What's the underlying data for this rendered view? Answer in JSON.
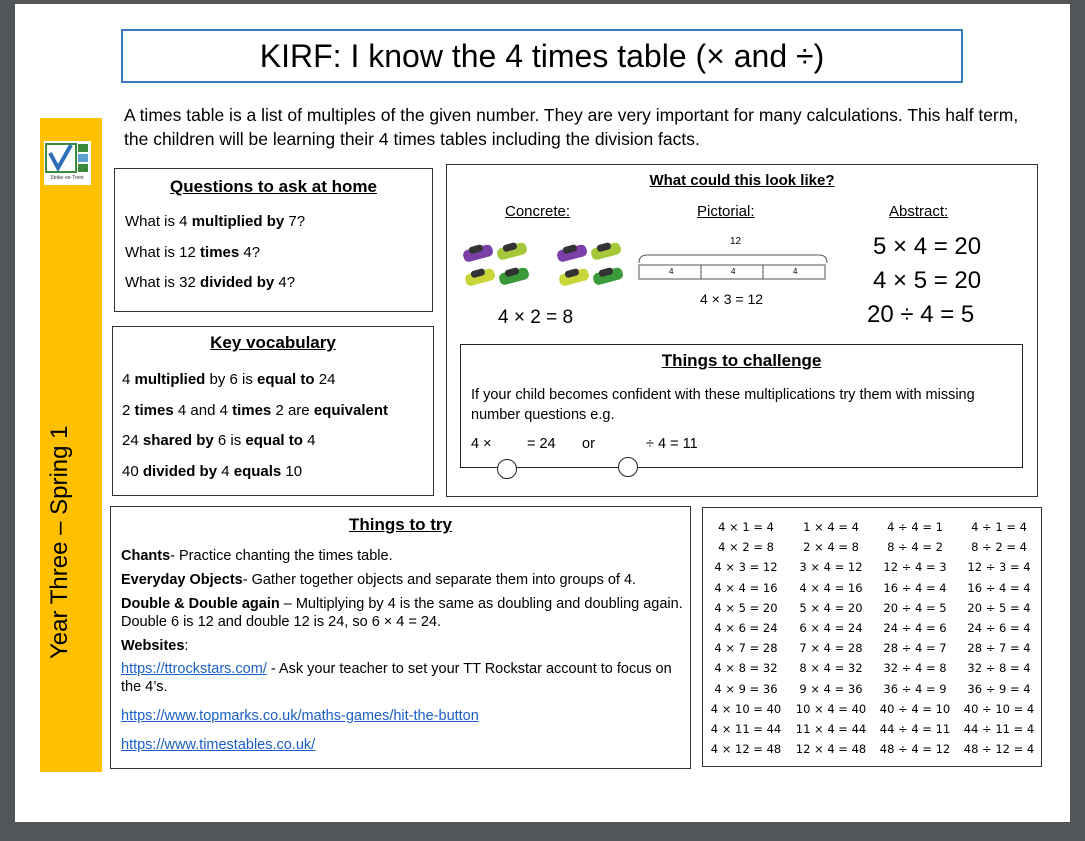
{
  "title": "KIRF: I know the 4 times table (× and ÷)",
  "intro": "A times table is a list of multiples of the given number. They are very important for many calculations. This half term, the children will be learning their 4 times tables including the division facts.",
  "sidebar_label": "Year Three – Spring 1",
  "logo_text": "Stoke-on-Trent",
  "questions": {
    "heading": "Questions to ask at home",
    "lines": [
      [
        {
          "t": "What is 4 ",
          "b": false
        },
        {
          "t": "multiplied by",
          "b": true
        },
        {
          "t": " 7?",
          "b": false
        }
      ],
      [
        {
          "t": "What is 12 ",
          "b": false
        },
        {
          "t": "times",
          "b": true
        },
        {
          "t": " 4?",
          "b": false
        }
      ],
      [
        {
          "t": "What is 32 ",
          "b": false
        },
        {
          "t": "divided by",
          "b": true
        },
        {
          "t": " 4?",
          "b": false
        }
      ]
    ]
  },
  "vocabulary": {
    "heading": "Key vocabulary",
    "lines": [
      [
        {
          "t": "4 ",
          "b": false
        },
        {
          "t": "multiplied",
          "b": true
        },
        {
          "t": " by 6 is ",
          "b": false
        },
        {
          "t": "equal to",
          "b": true
        },
        {
          "t": " 24",
          "b": false
        }
      ],
      [
        {
          "t": "2 ",
          "b": false
        },
        {
          "t": "times",
          "b": true
        },
        {
          "t": " 4 and 4 ",
          "b": false
        },
        {
          "t": "times",
          "b": true
        },
        {
          "t": " 2 are ",
          "b": false
        },
        {
          "t": "equivalent",
          "b": true
        }
      ],
      [
        {
          "t": "24 ",
          "b": false
        },
        {
          "t": "shared by",
          "b": true
        },
        {
          "t": " 6 is ",
          "b": false
        },
        {
          "t": "equal to",
          "b": true
        },
        {
          "t": " 4",
          "b": false
        }
      ],
      [
        {
          "t": "40 ",
          "b": false
        },
        {
          "t": "divided by",
          "b": true
        },
        {
          "t": " 4 ",
          "b": false
        },
        {
          "t": "equals",
          "b": true
        },
        {
          "t": " 10",
          "b": false
        }
      ]
    ]
  },
  "look_like": {
    "heading": "What could this look like?",
    "concrete_label": "Concrete:",
    "pictorial_label": "Pictorial:",
    "abstract_label": "Abstract:",
    "concrete_equation": "4 × 2 = 8",
    "bar_total": "12",
    "bar_parts": [
      "4",
      "4",
      "4"
    ],
    "pictorial_equation": "4 × 3 = 12",
    "abstract_equations": [
      "5 × 4 = 20",
      "4 × 5 = 20",
      "20 ÷ 4 = 5"
    ]
  },
  "challenge": {
    "heading": "Things to challenge",
    "text": "If your child becomes confident with these multiplications try them with missing number questions e.g.",
    "q1_left": "4 ×",
    "q1_right": "= 24",
    "or": "or",
    "q2_right": "÷ 4 = 11"
  },
  "things_to_try": {
    "heading": "Things to try",
    "chants_label": "Chants",
    "chants_text": "- Practice chanting the times table.",
    "objects_label": "Everyday Objects",
    "objects_text": "- Gather together objects and separate them into groups of 4.",
    "double_label": "Double & Double again",
    "double_text": " – Multiplying by 4 is the same as doubling and doubling again. Double 6 is 12 and double 12 is 24, so 6 × 4 = 24.",
    "websites_label": "Websites",
    "websites_colon": ":",
    "link1": "https://ttrockstars.com/",
    "link1_text": " - Ask your teacher to set your TT Rockstar account to focus on the 4’s.",
    "link2": "https://www.topmarks.co.uk/maths-games/hit-the-button",
    "link3": "https://www.timestables.co.uk/"
  },
  "tables": {
    "col1": [
      "4 × 1 = 4",
      "4 × 2 = 8",
      "4 × 3 = 12",
      "4 × 4 = 16",
      "4 × 5 = 20",
      "4 × 6 = 24",
      "4 × 7 = 28",
      "4 × 8 = 32",
      "4 × 9 = 36",
      "4 × 10 = 40",
      "4 × 11 = 44",
      "4 × 12 = 48"
    ],
    "col2": [
      "1 × 4 = 4",
      "2 × 4 = 8",
      "3 × 4 = 12",
      "4 × 4 = 16",
      "5 × 4 = 20",
      "6 × 4 = 24",
      "7 × 4 = 28",
      "8 × 4 = 32",
      "9 × 4 = 36",
      "10 × 4 = 40",
      "11 × 4 = 44",
      "12 × 4 = 48"
    ],
    "col3": [
      "4 ÷ 4 = 1",
      "8 ÷ 4 = 2",
      "12 ÷ 4 = 3",
      "16 ÷ 4 = 4",
      "20 ÷ 4 = 5",
      "24 ÷ 4 = 6",
      "28 ÷ 4 = 7",
      "32 ÷ 4 = 8",
      "36 ÷ 4 = 9",
      "40 ÷ 4 = 10",
      "44 ÷ 4 = 11",
      "48 ÷ 4 = 12"
    ],
    "col4": [
      "4 ÷ 1 = 4",
      "8 ÷ 2 = 4",
      "12 ÷ 3 = 4",
      "16 ÷ 4 = 4",
      "20 ÷ 5 = 4",
      "24 ÷ 6 = 4",
      "28 ÷ 7 = 4",
      "32 ÷ 8 = 4",
      "36 ÷ 9 = 4",
      "40 ÷ 10 = 4",
      "44 ÷ 11 = 4",
      "48 ÷ 12 = 4"
    ]
  },
  "colors": {
    "sidebar": "#ffc000",
    "title_border": "#3b78c7",
    "link": "#1a5fc7"
  }
}
